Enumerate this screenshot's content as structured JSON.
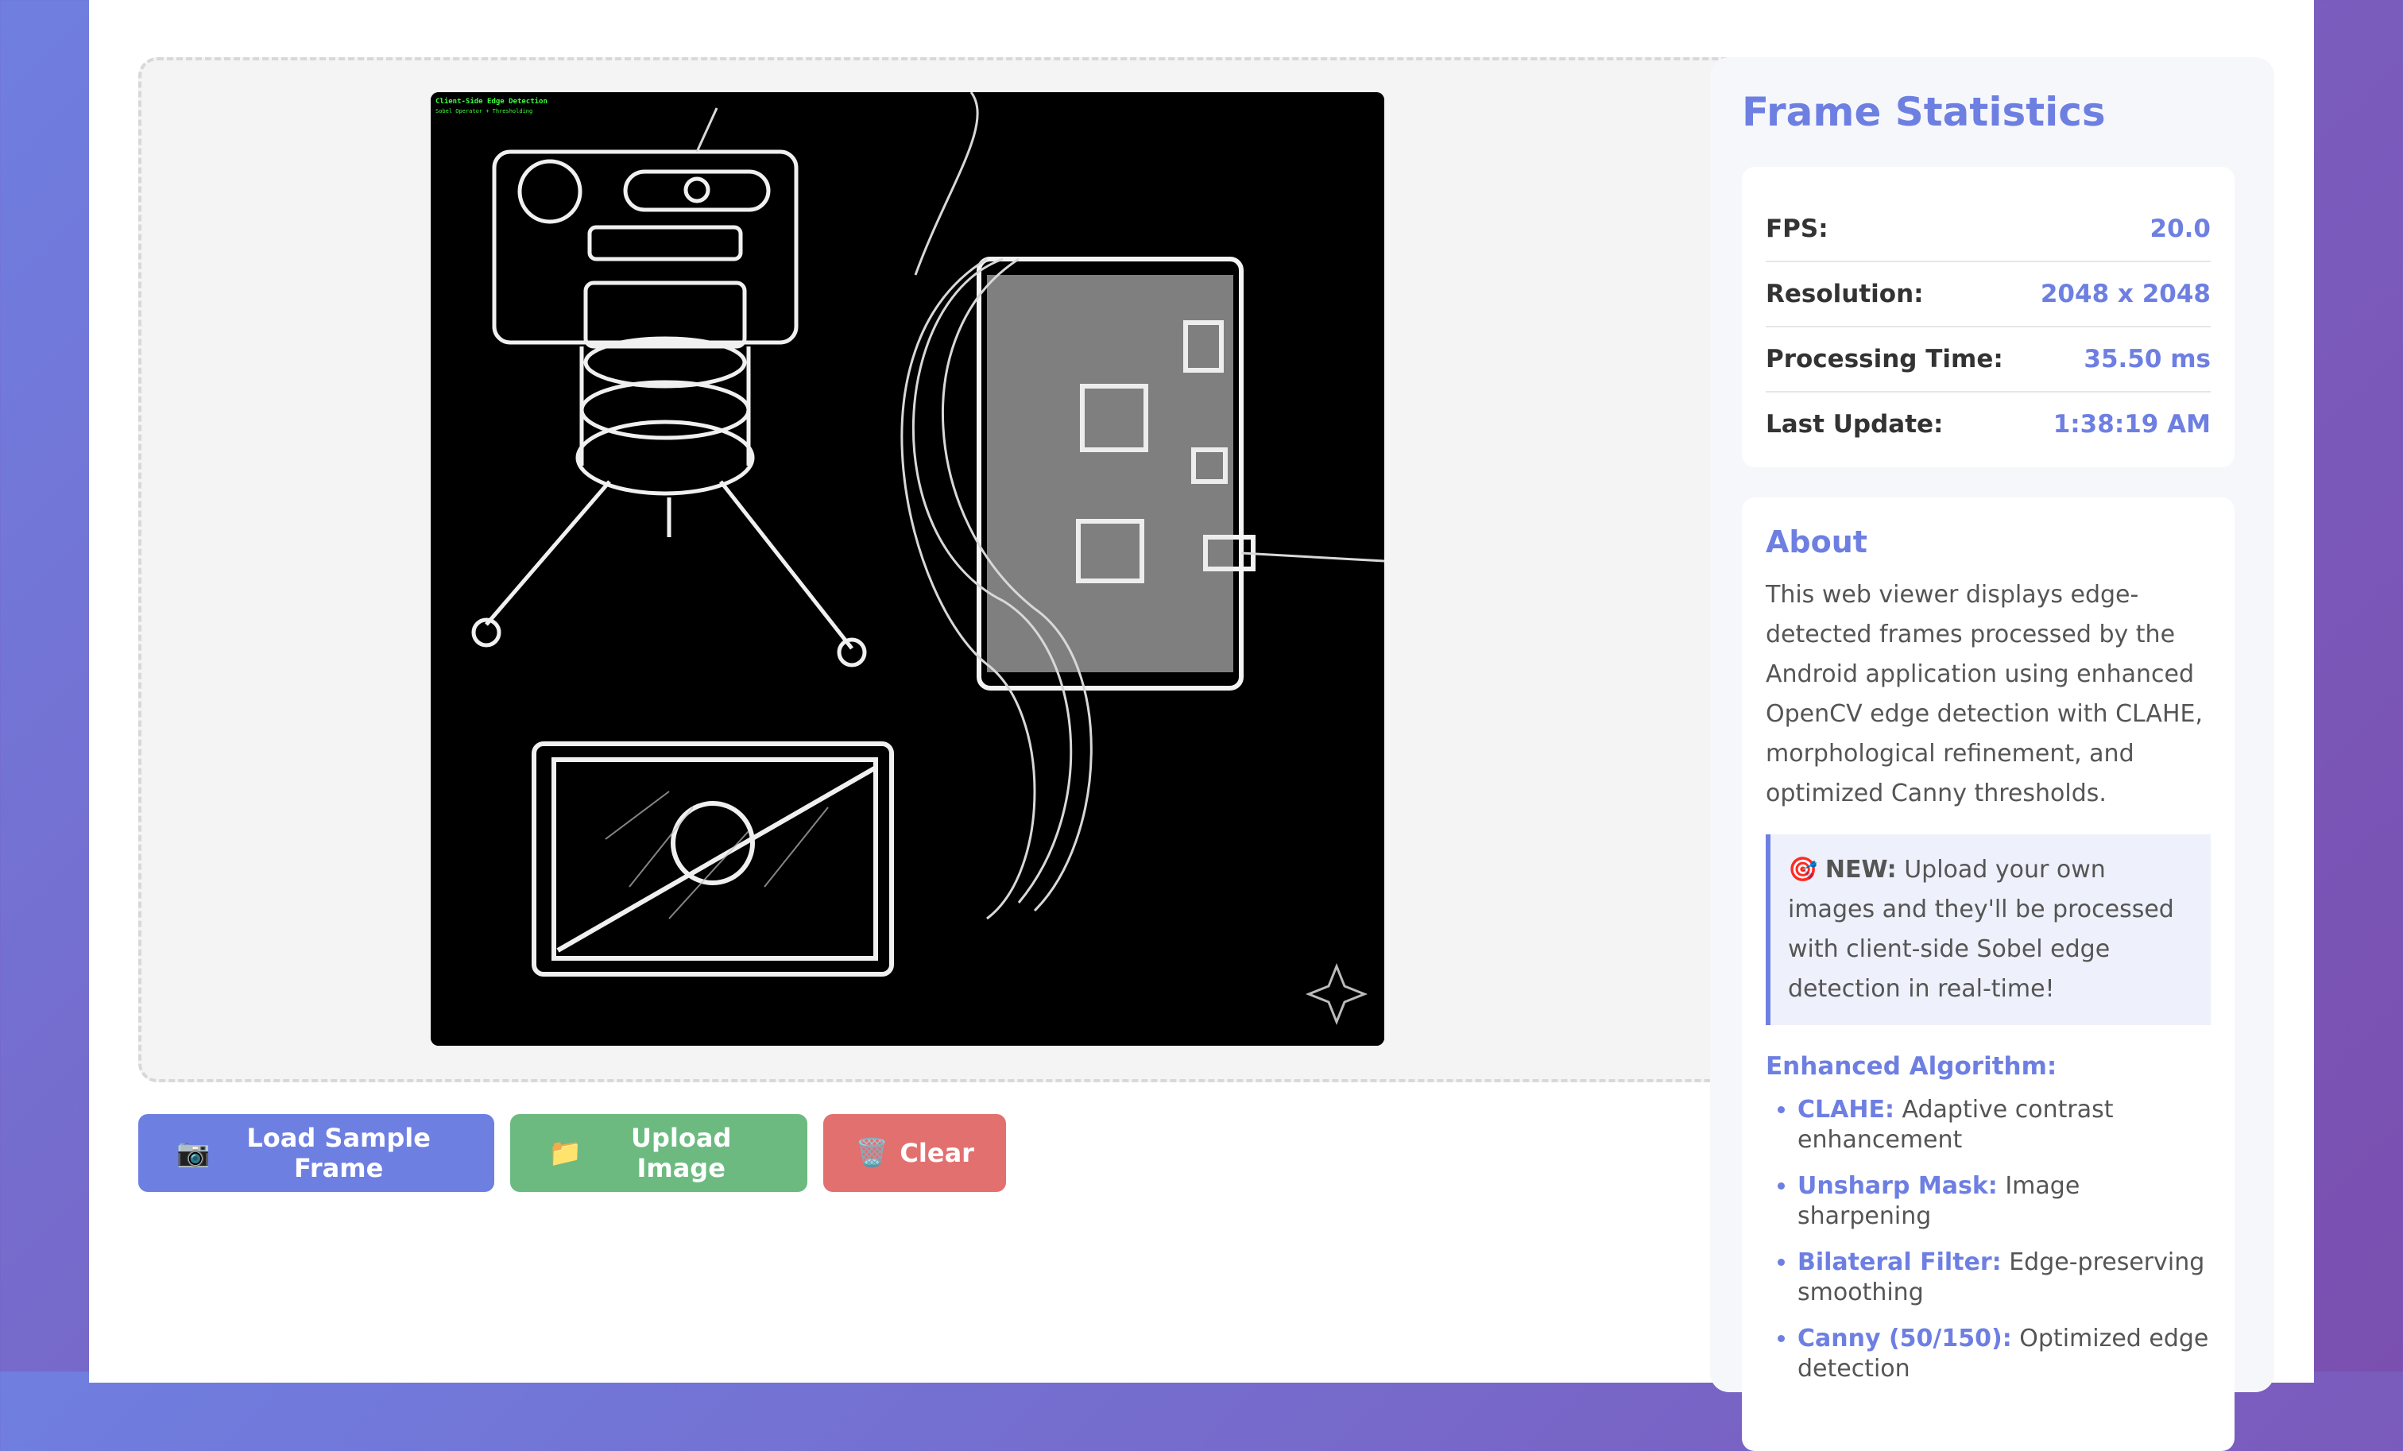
{
  "frame": {
    "overlay_title": "Client-Side Edge Detection",
    "overlay_subtitle": "Sobel Operator + Thresholding"
  },
  "buttons": {
    "load": {
      "icon": "📷",
      "label": "Load Sample Frame"
    },
    "upload": {
      "icon": "📁",
      "label": "Upload Image"
    },
    "clear": {
      "icon": "🗑️",
      "label": "Clear"
    }
  },
  "stats": {
    "title": "Frame Statistics",
    "rows": [
      {
        "label": "FPS:",
        "value": "20.0"
      },
      {
        "label": "Resolution:",
        "value": "2048 x 2048"
      },
      {
        "label": "Processing Time:",
        "value": "35.50 ms"
      },
      {
        "label": "Last Update:",
        "value": "1:38:19 AM"
      }
    ]
  },
  "about": {
    "title": "About",
    "text": "This web viewer displays edge-detected frames processed by the Android application using enhanced OpenCV edge detection with CLAHE, morphological refinement, and optimized Canny thresholds.",
    "new_icon": "🎯",
    "new_label": "NEW:",
    "new_text": " Upload your own images and they'll be processed with client-side Sobel edge detection in real-time!",
    "algo_title": "Enhanced Algorithm:",
    "algo": [
      {
        "key": "CLAHE:",
        "desc": " Adaptive contrast enhancement"
      },
      {
        "key": "Unsharp Mask:",
        "desc": " Image sharpening"
      },
      {
        "key": "Bilateral Filter:",
        "desc": " Edge-preserving smoothing"
      },
      {
        "key": "Canny (50/150):",
        "desc": " Optimized edge detection"
      }
    ]
  },
  "colors": {
    "accent": "#6e7fe2",
    "upload_green": "#6cba80",
    "clear_red": "#e2706f"
  }
}
